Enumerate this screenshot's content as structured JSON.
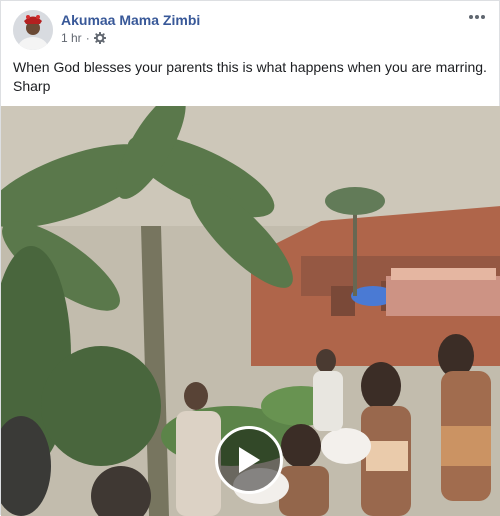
{
  "post": {
    "author": "Akumaa Mama Zimbi",
    "timestamp": "1 hr",
    "separator": "·",
    "privacy_icon": "gear-icon",
    "more_icon": "more-options-icon",
    "caption": "When God blesses your parents this is what happens when you are marring. Sharp"
  },
  "video": {
    "play_icon": "play-icon"
  },
  "colors": {
    "author_link": "#385898",
    "meta_text": "#616770",
    "border": "#dddfe2"
  }
}
